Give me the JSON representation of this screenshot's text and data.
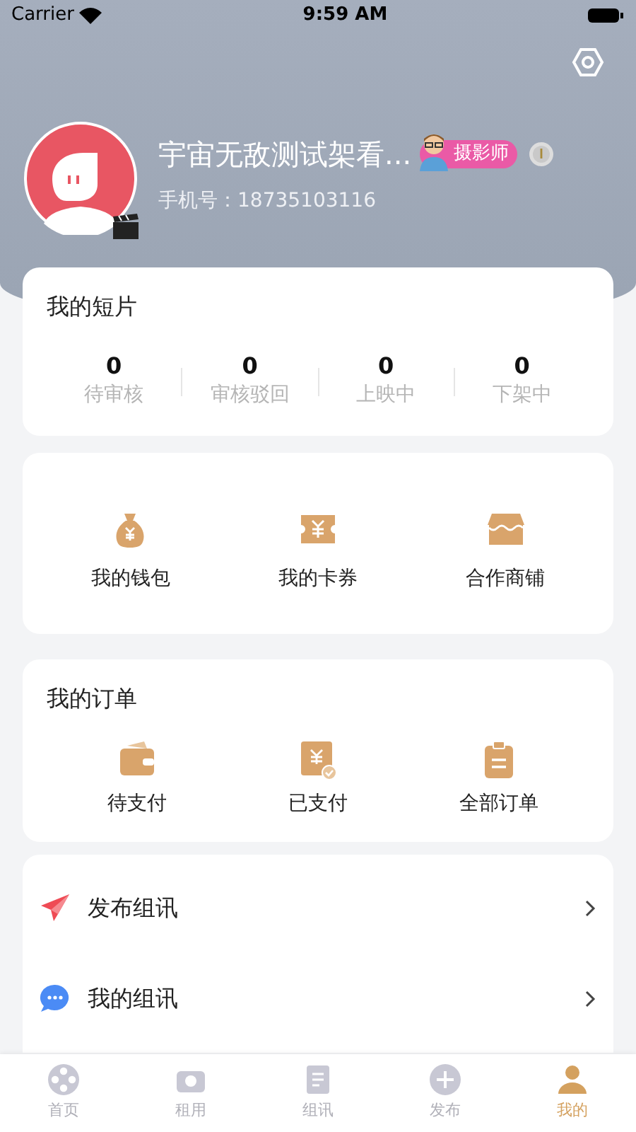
{
  "status_bar": {
    "carrier": "Carrier",
    "time": "9:59 AM"
  },
  "profile": {
    "name": "宇宙无敌测试架看...",
    "role_badge": "摄影师",
    "phone": "手机号：18735103116"
  },
  "shorts": {
    "title": "我的短片",
    "stats": [
      {
        "value": "0",
        "label": "待审核"
      },
      {
        "value": "0",
        "label": "审核驳回"
      },
      {
        "value": "0",
        "label": "上映中"
      },
      {
        "value": "0",
        "label": "下架中"
      }
    ]
  },
  "services": [
    {
      "kind": "wallet",
      "label": "我的钱包"
    },
    {
      "kind": "coupon",
      "label": "我的卡券"
    },
    {
      "kind": "shop",
      "label": "合作商铺"
    }
  ],
  "orders": {
    "title": "我的订单",
    "items": [
      {
        "kind": "unpaid",
        "label": "待支付"
      },
      {
        "kind": "paid",
        "label": "已支付"
      },
      {
        "kind": "all",
        "label": "全部订单"
      }
    ]
  },
  "menu": [
    {
      "kind": "publish",
      "label": "发布组讯"
    },
    {
      "kind": "messages",
      "label": "我的组讯"
    }
  ],
  "tab_bar": [
    {
      "label": "首页",
      "selected": false
    },
    {
      "label": "租用",
      "selected": false
    },
    {
      "label": "组讯",
      "selected": false
    },
    {
      "label": "发布",
      "selected": false
    },
    {
      "label": "我的",
      "selected": true
    }
  ]
}
